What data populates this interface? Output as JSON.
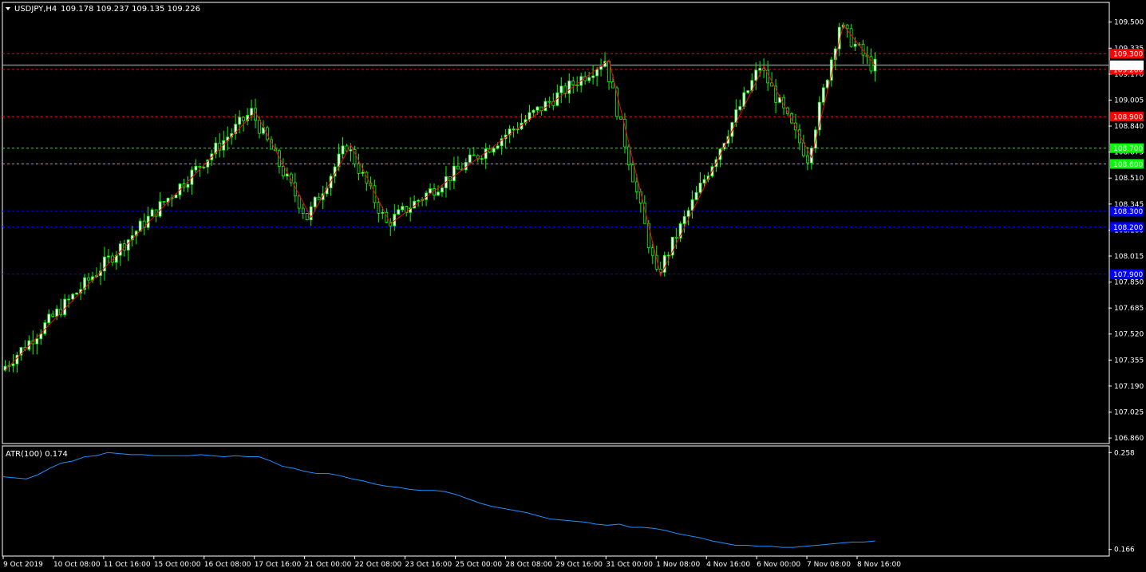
{
  "header": {
    "symbol_label": "USDJPY,H4",
    "ohlc_text": "109.178 109.237 109.135 109.226"
  },
  "indicator": {
    "label": "ATR(100) 0.174"
  },
  "colors": {
    "background": "#000000",
    "grid": "#ffffff",
    "bull_candle": "#ffffff",
    "bear_candle": "#000000",
    "wick": "#00ff00",
    "zigzag": "#ff0000",
    "atr_line": "#1e90ff",
    "resistance": "#ff0000",
    "support_green": "#00ff00",
    "support_blue": "#0000ff",
    "price_line": "#c0c0c0"
  },
  "chart_data": [
    {
      "type": "candlestick",
      "title": "USDJPY,H4",
      "y_ticks": [
        "109.500",
        "109.335",
        "109.170",
        "109.005",
        "108.840",
        "108.675",
        "108.510",
        "108.345",
        "108.180",
        "108.015",
        "107.850",
        "107.685",
        "107.520",
        "107.355",
        "107.190",
        "107.025",
        "106.860"
      ],
      "x_ticks": [
        "9 Oct 2019",
        "10 Oct 08:00",
        "11 Oct 16:00",
        "15 Oct 00:00",
        "16 Oct 08:00",
        "17 Oct 16:00",
        "21 Oct 00:00",
        "22 Oct 08:00",
        "23 Oct 16:00",
        "25 Oct 00:00",
        "28 Oct 08:00",
        "29 Oct 16:00",
        "31 Oct 00:00",
        "1 Nov 08:00",
        "4 Nov 16:00",
        "6 Nov 00:00",
        "7 Nov 08:00",
        "8 Nov 16:00"
      ],
      "ylim": [
        106.83,
        109.62
      ],
      "current_price": "109.226",
      "levels": [
        {
          "price": 109.3,
          "label": "109.300",
          "kind": "resistance"
        },
        {
          "price": 109.2,
          "label": "109.200",
          "kind": "resistance"
        },
        {
          "price": 108.9,
          "label": "108.900",
          "kind": "resistance"
        },
        {
          "price": 108.7,
          "label": "108.700",
          "kind": "support_green"
        },
        {
          "price": 108.6,
          "label": "108.600",
          "kind": "support_green"
        },
        {
          "price": 108.3,
          "label": "108.300",
          "kind": "support_blue"
        },
        {
          "price": 108.2,
          "label": "108.200",
          "kind": "support_blue"
        },
        {
          "price": 107.9,
          "label": "107.900",
          "kind": "support_blue"
        }
      ],
      "zigzag": [
        {
          "bar": 0,
          "price": 107.29
        },
        {
          "bar": 63,
          "price": 108.93
        },
        {
          "bar": 77,
          "price": 108.26
        },
        {
          "bar": 87,
          "price": 108.72
        },
        {
          "bar": 97,
          "price": 108.22
        },
        {
          "bar": 152,
          "price": 109.26
        },
        {
          "bar": 165,
          "price": 107.89
        },
        {
          "bar": 191,
          "price": 109.22
        },
        {
          "bar": 203,
          "price": 108.64
        },
        {
          "bar": 211,
          "price": 109.48
        },
        {
          "bar": 219,
          "price": 109.226
        }
      ],
      "bar_count": 220
    },
    {
      "type": "line",
      "title": "ATR(100) 0.174",
      "y_ticks": [
        "0.258",
        "0.166"
      ],
      "ylim": [
        0.162,
        0.262
      ],
      "series": [
        {
          "name": "ATR(100)",
          "values": [
            0.235,
            0.234,
            0.233,
            0.237,
            0.243,
            0.248,
            0.25,
            0.254,
            0.255,
            0.258,
            0.257,
            0.256,
            0.256,
            0.255,
            0.255,
            0.255,
            0.255,
            0.256,
            0.255,
            0.254,
            0.255,
            0.254,
            0.254,
            0.25,
            0.245,
            0.243,
            0.24,
            0.238,
            0.238,
            0.236,
            0.233,
            0.231,
            0.228,
            0.226,
            0.225,
            0.223,
            0.222,
            0.222,
            0.221,
            0.218,
            0.214,
            0.21,
            0.207,
            0.205,
            0.203,
            0.201,
            0.198,
            0.195,
            0.194,
            0.193,
            0.192,
            0.19,
            0.189,
            0.19,
            0.187,
            0.187,
            0.186,
            0.184,
            0.181,
            0.179,
            0.177,
            0.174,
            0.172,
            0.17,
            0.17,
            0.169,
            0.169,
            0.168,
            0.168,
            0.169,
            0.17,
            0.171,
            0.172,
            0.173,
            0.173,
            0.174
          ]
        }
      ]
    }
  ]
}
